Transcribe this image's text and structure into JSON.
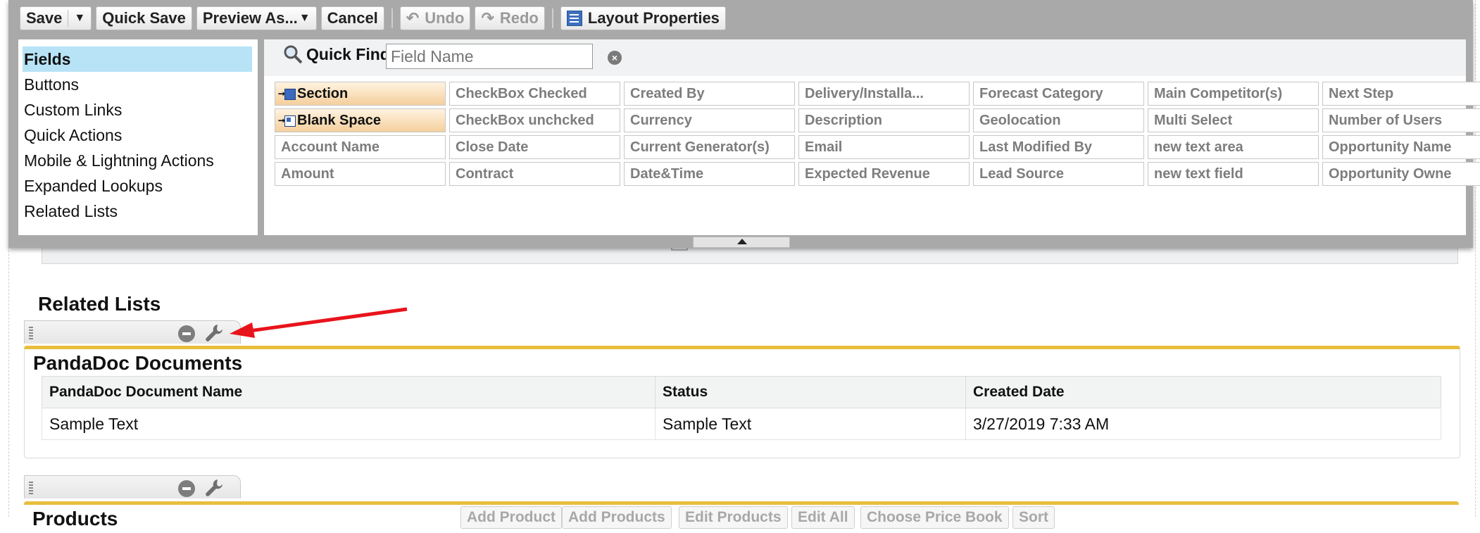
{
  "toolbar": {
    "save": "Save",
    "quick_save": "Quick Save",
    "preview_as": "Preview As...",
    "cancel": "Cancel",
    "undo": "Undo",
    "redo": "Redo",
    "layout_properties": "Layout Properties"
  },
  "palette": {
    "categories": [
      "Fields",
      "Buttons",
      "Custom Links",
      "Quick Actions",
      "Mobile & Lightning Actions",
      "Expanded Lookups",
      "Related Lists"
    ],
    "selected_category": "Fields",
    "quick_find": {
      "label": "Quick Find",
      "placeholder": "Field Name",
      "value": ""
    },
    "fields": [
      [
        "Section",
        "CheckBox Checked",
        "Created By",
        "Delivery/Installa...",
        "Forecast Category",
        "Main Competitor(s)",
        "Next Step"
      ],
      [
        "Blank Space",
        "CheckBox unchcked",
        "Currency",
        "Description",
        "Geolocation",
        "Multi Select",
        "Number of Users"
      ],
      [
        "Account Name",
        "Close Date",
        "Current Generator(s)",
        "Email",
        "Last Modified By",
        "new text area",
        "Opportunity Name"
      ],
      [
        "Amount",
        "Contract",
        "Date&Time",
        "Expected Revenue",
        "Lead Source",
        "new text field",
        "Opportunity Owne"
      ]
    ]
  },
  "related_lists_heading": "Related Lists",
  "pandadoc": {
    "title": "PandaDoc Documents",
    "columns": [
      "PandaDoc Document Name",
      "Status",
      "Created Date"
    ],
    "row": [
      "Sample Text",
      "Sample Text",
      "3/27/2019 7:33 AM"
    ]
  },
  "products": {
    "title": "Products",
    "buttons": [
      "Add Product",
      "Add Products",
      "Edit Products",
      "Edit All",
      "Choose Price Book",
      "Sort"
    ]
  },
  "colors": {
    "accent": "#e8be3c",
    "selected": "#b8e3f7",
    "arrow": "#e8141b"
  }
}
